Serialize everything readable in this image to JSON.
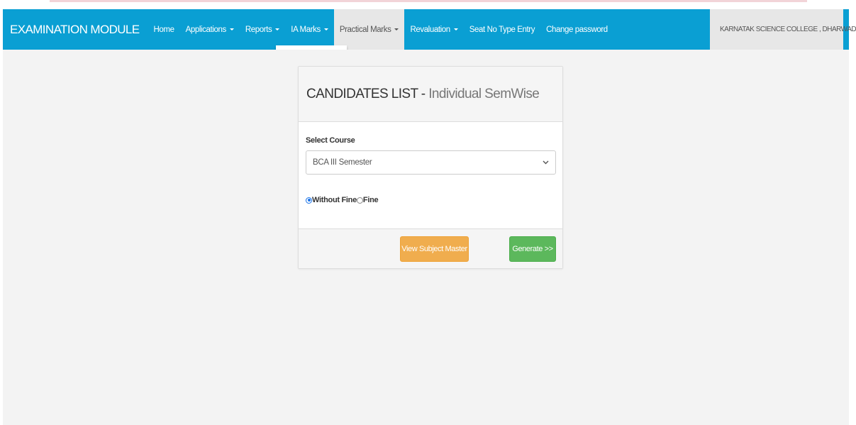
{
  "navbar": {
    "brand": "EXAMINATION MODULE",
    "items": [
      {
        "label": "Home",
        "caret": false
      },
      {
        "label": "Applications",
        "caret": true
      },
      {
        "label": "Reports",
        "caret": true
      },
      {
        "label": "IA Marks",
        "caret": true
      },
      {
        "label": "Practical Marks",
        "caret": true,
        "active": true
      },
      {
        "label": "Revaluation",
        "caret": true
      },
      {
        "label": "Seat No Type Entry",
        "caret": false
      },
      {
        "label": "Change password",
        "caret": false
      }
    ],
    "user": "KARNATAK SCIENCE COLLEGE , DHARWAD."
  },
  "panel": {
    "title": "CANDIDATES LIST -",
    "subtitle": "Individual SemWise",
    "course_label": "Select Course",
    "course_value": "BCA III Semester",
    "radio_without_fine": "Without Fine",
    "radio_fine": "Fine",
    "view_button": "View Subject Master",
    "generate_button": "Generate >>"
  },
  "colors": {
    "navbar": "#0a9fd3",
    "warning": "#f0ad4e",
    "success": "#5cb85c"
  }
}
